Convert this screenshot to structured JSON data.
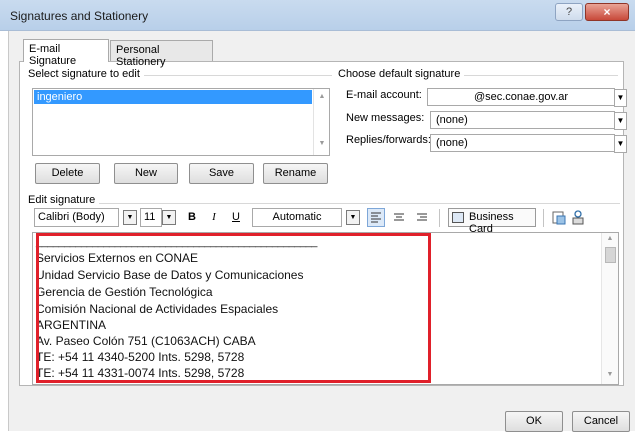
{
  "window": {
    "title": "Signatures and Stationery",
    "help_label": "?",
    "close_label": "×"
  },
  "tabs": [
    {
      "label": "E-mail Signature",
      "active": true
    },
    {
      "label": "Personal Stationery",
      "active": false
    }
  ],
  "select_signature": {
    "label": "Select signature to edit",
    "items": [
      "ingeniero"
    ],
    "selected": "ingeniero"
  },
  "buttons": {
    "delete": "Delete",
    "new": "New",
    "save": "Save",
    "rename": "Rename",
    "ok": "OK",
    "cancel": "Cancel"
  },
  "default_signature": {
    "label": "Choose default signature",
    "email_account_label": "E-mail account:",
    "email_account_value": "@sec.conae.gov.ar",
    "new_messages_label": "New messages:",
    "new_messages_value": "(none)",
    "replies_label": "Replies/forwards:",
    "replies_value": "(none)"
  },
  "edit_signature": {
    "label": "Edit signature",
    "font": "Calibri (Body)",
    "size": "11",
    "bold": "B",
    "italic": "I",
    "underline": "U",
    "color": "Automatic",
    "business_card": "Business Card"
  },
  "signature_lines": [
    "__________________________________________________",
    "Servicios Externos en CONAE",
    "Unidad Servicio Base de Datos y Comunicaciones",
    "Gerencia de Gestión Tecnológica",
    "Comisión Nacional de Actividades Espaciales",
    "ARGENTINA",
    "Av. Paseo Colón 751  (C1063ACH) CABA",
    "TE: +54 11 4340-5200  Ints. 5298, 5728",
    "TE: +54 11 4331-0074  Ints. 5298, 5728"
  ],
  "colors": {
    "highlight_border": "#e0202a",
    "selection": "#3399ff"
  }
}
